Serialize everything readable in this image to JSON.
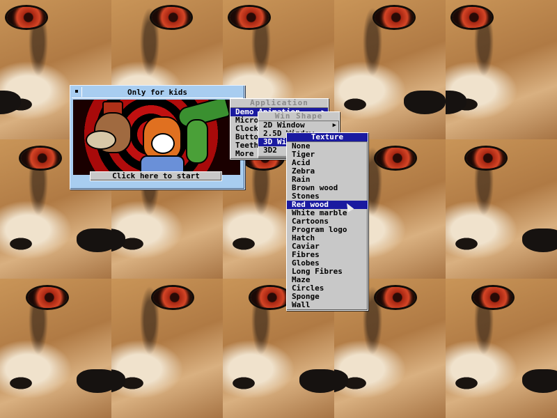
{
  "kids_window": {
    "title": "Only for kids",
    "start_button": "Click here to start"
  },
  "application_menu": {
    "title": "Application",
    "items": [
      "Demo Animation",
      "Micro",
      "Clock",
      "Buttons",
      "Teeth",
      "More"
    ]
  },
  "winshape_menu": {
    "title": "Win Shape",
    "items": [
      "2D Window",
      "2.5D Window",
      "3D Window",
      "3D2"
    ]
  },
  "texture_menu": {
    "title": "Texture",
    "selected": "Red wood",
    "items": [
      "None",
      "Tiger",
      "Acid",
      "Zebra",
      "Rain",
      "Brown wood",
      "Stones",
      "Red wood",
      "White marble",
      "Cartoons",
      "Program logo",
      "Hatch",
      "Caviar",
      "Fibres",
      "Globes",
      "Long Fibres",
      "Maze",
      "Circles",
      "Sponge",
      "Wall"
    ]
  },
  "icons": {
    "close": "close-icon",
    "submenu": "submenu-arrow-icon",
    "pointer": "mouse-pointer-icon"
  },
  "colors": {
    "highlight": "#1a1aa0",
    "menu_bg": "#c8c8c8",
    "window_bg": "#a8cdf0"
  }
}
